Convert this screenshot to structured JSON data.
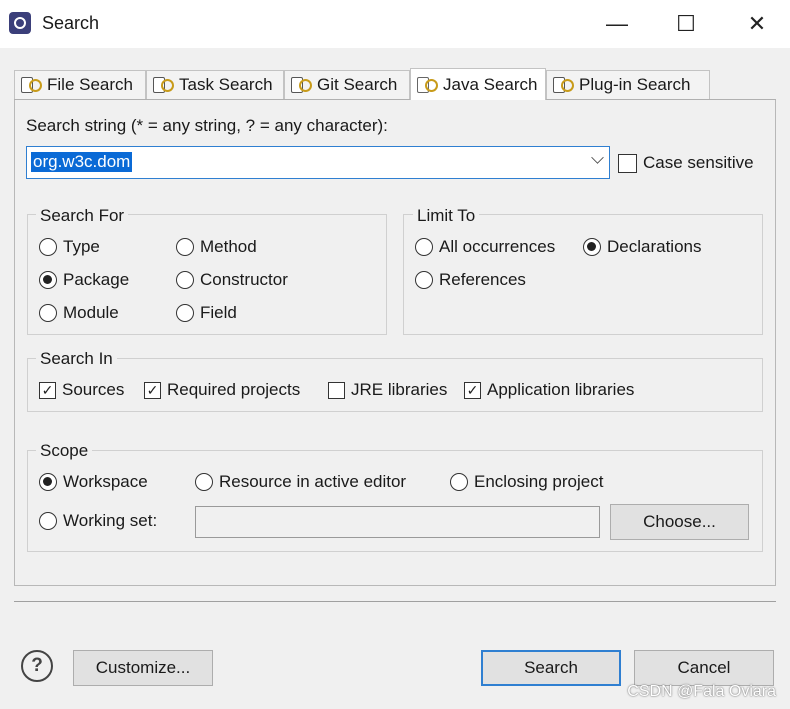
{
  "window": {
    "title": "Search",
    "minimize": "—",
    "maximize": "☐",
    "close": "✕"
  },
  "tabs": [
    {
      "label": "File Search"
    },
    {
      "label": "Task Search"
    },
    {
      "label": "Git Search"
    },
    {
      "label": "Java Search"
    },
    {
      "label": "Plug-in Search"
    }
  ],
  "active_tab": "Java Search",
  "search_string": {
    "label": "Search string (* = any string, ? = any character):",
    "value": "org.w3c.dom",
    "case_sensitive_label": "Case sensitive",
    "case_sensitive": false
  },
  "search_for": {
    "title": "Search For",
    "options": [
      "Type",
      "Method",
      "Package",
      "Constructor",
      "Module",
      "Field"
    ],
    "selected": "Package"
  },
  "limit_to": {
    "title": "Limit To",
    "options": [
      "All occurrences",
      "Declarations",
      "References"
    ],
    "selected": "Declarations"
  },
  "search_in": {
    "title": "Search In",
    "options": [
      {
        "label": "Sources",
        "checked": true
      },
      {
        "label": "Required projects",
        "checked": true
      },
      {
        "label": "JRE libraries",
        "checked": false
      },
      {
        "label": "Application libraries",
        "checked": true
      }
    ]
  },
  "scope": {
    "title": "Scope",
    "options": [
      "Workspace",
      "Resource in active editor",
      "Enclosing project",
      "Working set:"
    ],
    "selected": "Workspace",
    "working_set_value": "",
    "choose_label": "Choose..."
  },
  "footer": {
    "customize_label": "Customize...",
    "search_label": "Search",
    "cancel_label": "Cancel",
    "help_glyph": "?"
  },
  "watermark": "CSDN @Fala Oviara"
}
